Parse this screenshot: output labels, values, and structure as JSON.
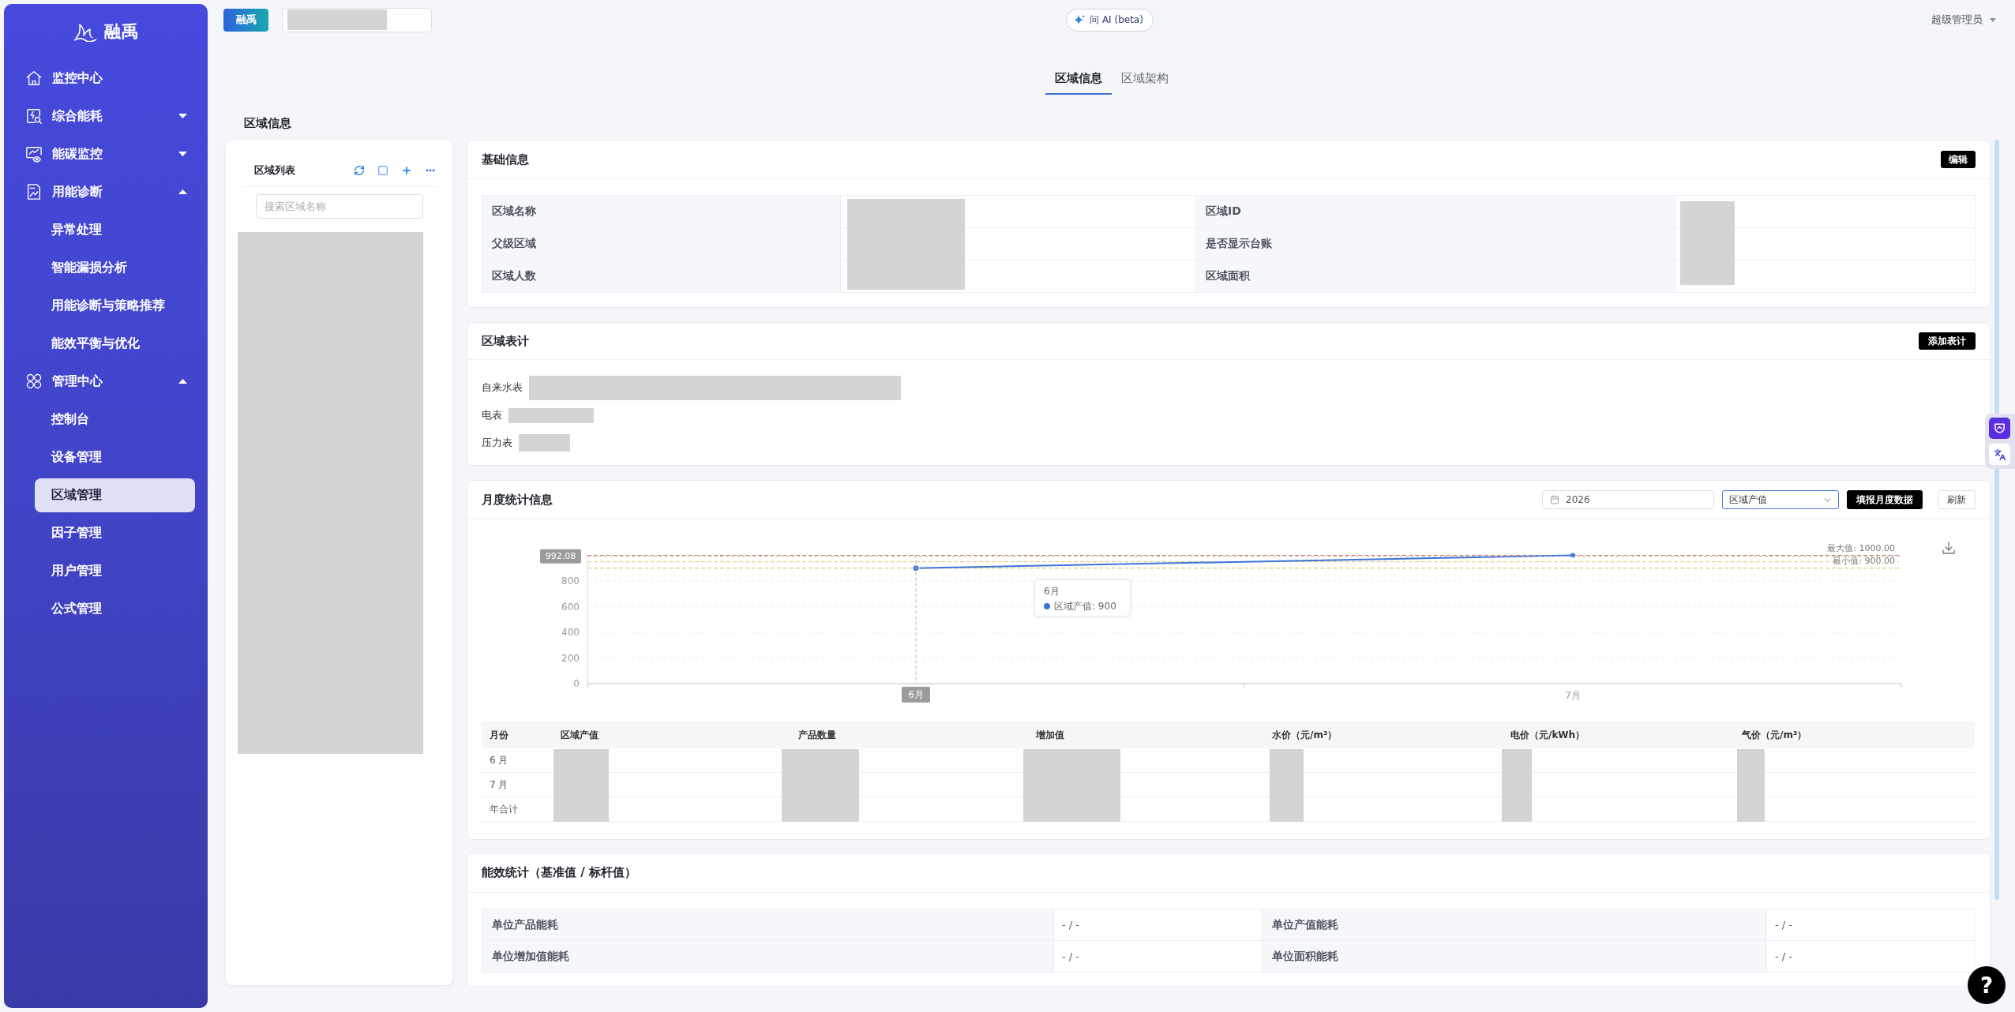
{
  "sidebar": {
    "logo": "融禹",
    "items": [
      {
        "label": "监控中心",
        "selected": false
      },
      {
        "label": "综合能耗",
        "selected": false,
        "expanded": false
      },
      {
        "label": "能碳监控",
        "selected": false,
        "expanded": false
      },
      {
        "label": "用能诊断",
        "selected": false,
        "expanded": true,
        "children": [
          {
            "label": "异常处理",
            "selected": false
          },
          {
            "label": "智能漏损分析",
            "selected": false
          },
          {
            "label": "用能诊断与策略推荐",
            "selected": false
          },
          {
            "label": "能效平衡与优化",
            "selected": false
          }
        ]
      },
      {
        "label": "管理中心",
        "selected": false,
        "expanded": true,
        "children": [
          {
            "label": "控制台",
            "selected": false
          },
          {
            "label": "设备管理",
            "selected": false
          },
          {
            "label": "区域管理",
            "selected": true
          },
          {
            "label": "因子管理",
            "selected": false
          },
          {
            "label": "用户管理",
            "selected": false
          },
          {
            "label": "公式管理",
            "selected": false
          }
        ]
      }
    ]
  },
  "header": {
    "brand": "融禹",
    "ai_button": "问 AI (beta)",
    "user": "超级管理员"
  },
  "tabs": [
    {
      "label": "区域信息",
      "selected": true
    },
    {
      "label": "区域架构",
      "selected": false
    }
  ],
  "page_title": "区域信息",
  "region_list": {
    "title": "区域列表",
    "search": {
      "placeholder": "搜索区域名称"
    }
  },
  "basic_info": {
    "title": "基础信息",
    "edit_button": "编辑",
    "rows": [
      {
        "label_1": "区域名称",
        "label_2": "区域ID"
      },
      {
        "label_1": "父级区域",
        "label_2": "是否显示台账"
      },
      {
        "label_1": "区域人数",
        "label_2": "区域面积"
      }
    ]
  },
  "meters": {
    "title": "区域表计",
    "add_button": "添加表计",
    "items": [
      {
        "label": "自来水表"
      },
      {
        "label": "电表"
      },
      {
        "label": "压力表"
      }
    ]
  },
  "monthly": {
    "title": "月度统计信息",
    "year": "2026",
    "metric": "区域产值",
    "report_button": "填报月度数据",
    "refresh_button": "刷新",
    "chart_data": {
      "type": "line",
      "categories": [
        "6月",
        "7月"
      ],
      "series": [
        {
          "color": "#3b74d9",
          "marker": "circle",
          "values": [
            900,
            1000
          ]
        }
      ],
      "ylim": [
        0,
        1000
      ],
      "yticks": [
        0,
        200,
        400,
        600,
        800
      ],
      "grid": true,
      "ref_lines": [
        {
          "axis": "y",
          "value": 1000,
          "label": "最大值: 1000.00",
          "color": "#e0796c"
        },
        {
          "axis": "y",
          "value": 950,
          "color": "#dcc36e"
        },
        {
          "axis": "y",
          "value": 900,
          "label": "最小值: 900.00",
          "color": "#d8bf55"
        }
      ]
    },
    "points": [
      {
        "hovered": true
      },
      {
        "hovered": false
      }
    ],
    "pointer_value": "992.08",
    "tooltip": {
      "title": "6月",
      "item": "区域产值: 900"
    },
    "table": {
      "columns": [
        "月份",
        "区域产值",
        "产品数量",
        "增加值",
        "水价（元/m³）",
        "电价（元/kWh）",
        "气价（元/m³）"
      ],
      "rows": [
        {
          "month": "6 月"
        },
        {
          "month": "7 月"
        },
        {
          "month": "年合计"
        }
      ]
    }
  },
  "efficiency": {
    "title": "能效统计（基准值 / 标杆值）",
    "rows": [
      {
        "label_1": "单位产品能耗",
        "value_1": "- / -",
        "label_2": "单位产值能耗",
        "value_2": "- / -"
      },
      {
        "label_1": "单位增加值能耗",
        "value_1": "- / -",
        "label_2": "单位面积能耗",
        "value_2": "- / -"
      }
    ]
  },
  "help_button": "?"
}
